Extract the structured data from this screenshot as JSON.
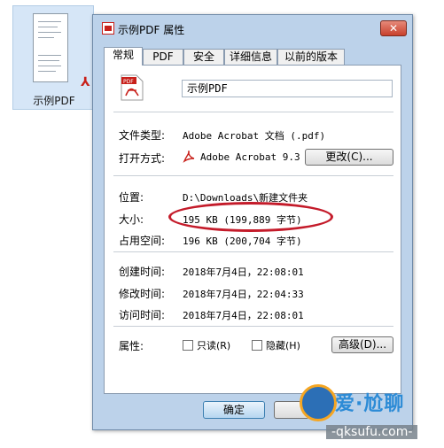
{
  "desktop": {
    "file_label": "示例PDF"
  },
  "window": {
    "title": "示例PDF 属性",
    "close_label": "✕"
  },
  "tabs": [
    {
      "label": "常规",
      "active": true
    },
    {
      "label": "PDF",
      "active": false
    },
    {
      "label": "安全",
      "active": false
    },
    {
      "label": "详细信息",
      "active": false
    },
    {
      "label": "以前的版本",
      "active": false
    }
  ],
  "general": {
    "file_name": "示例PDF",
    "file_type_label": "文件类型:",
    "file_type_value": "Adobe Acrobat 文档 (.pdf)",
    "opens_with_label": "打开方式:",
    "opens_with_value": "Adobe Acrobat 9.3",
    "change_button": "更改(C)...",
    "location_label": "位置:",
    "location_value": "D:\\Downloads\\新建文件夹",
    "size_label": "大小:",
    "size_value": "195 KB (199,889 字节)",
    "size_on_disk_label": "占用空间:",
    "size_on_disk_value": "196 KB (200,704 字节)",
    "created_label": "创建时间:",
    "created_value": "2018年7月4日，22:08:01",
    "modified_label": "修改时间:",
    "modified_value": "2018年7月4日，22:04:33",
    "accessed_label": "访问时间:",
    "accessed_value": "2018年7月4日，22:08:01",
    "attributes_label": "属性:",
    "readonly_label": "只读(R)",
    "hidden_label": "隐藏(H)",
    "advanced_button": "高级(D)..."
  },
  "footer": {
    "ok_button": "确定"
  },
  "watermark": {
    "top_text": "爱·尬聊",
    "bottom_text": "-qksufu.com-"
  },
  "colors": {
    "highlight": "#c41b2a",
    "pdf_red": "#c8201a",
    "window_chrome": "#bcd2ea"
  }
}
